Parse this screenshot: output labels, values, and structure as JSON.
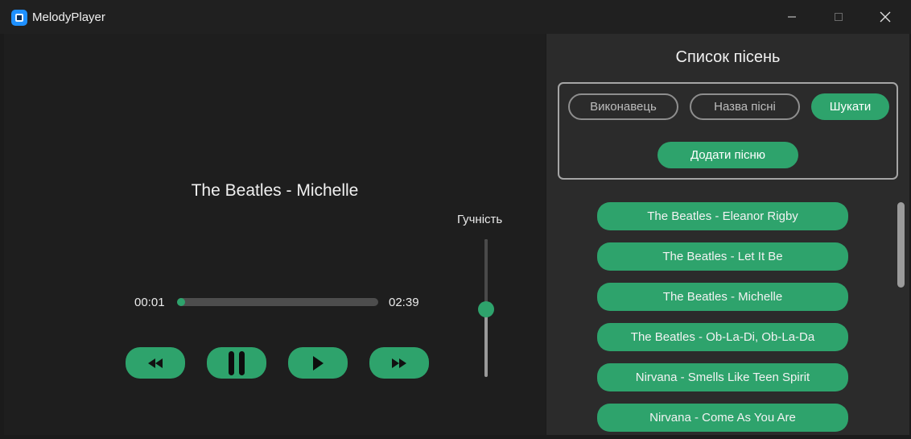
{
  "window": {
    "title": "MelodyPlayer",
    "icon": "app-logo-icon",
    "controls": [
      "minimize-icon",
      "maximize-icon",
      "close-icon"
    ]
  },
  "player": {
    "now_playing": "The Beatles - Michelle",
    "current_time": "00:01",
    "total_time": "02:39",
    "progress": 0.02,
    "controls": [
      "rewind-icon",
      "pause-icon",
      "play-icon",
      "fast-forward-icon"
    ],
    "volume_label": "Гучність",
    "volume": 0.5
  },
  "sidebar": {
    "title": "Список пісень",
    "artist_placeholder": "Виконавець",
    "song_placeholder": "Назва пісні",
    "search_label": "Шукати",
    "add_label": "Додати пісню",
    "songs": [
      "The Beatles - Eleanor Rigby",
      "The Beatles - Let It Be",
      "The Beatles - Michelle",
      "The Beatles - Ob-La-Di, Ob-La-Da",
      "Nirvana - Smells Like Teen Spirit",
      "Nirvana - Come As You Are"
    ]
  },
  "colors": {
    "accent": "#2ea36c",
    "background": "#1e1e1e",
    "panel": "#2b2b2b"
  }
}
